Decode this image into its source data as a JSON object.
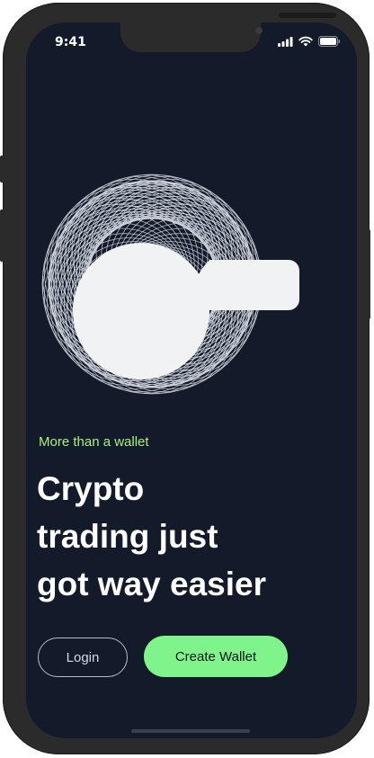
{
  "status_bar": {
    "time": "9:41",
    "icons": [
      "signal-icon",
      "wifi-icon",
      "battery-icon"
    ]
  },
  "hero": {
    "tagline": "More than a wallet",
    "headline_lines": [
      "Crypto",
      "trading just",
      "got way easier"
    ]
  },
  "actions": {
    "login_label": "Login",
    "create_wallet_label": "Create Wallet"
  },
  "colors": {
    "background": "#131a2a",
    "accent_green": "#7ef48a",
    "tagline_green": "#a8f27a",
    "device_frame": "#2b2b2b"
  }
}
